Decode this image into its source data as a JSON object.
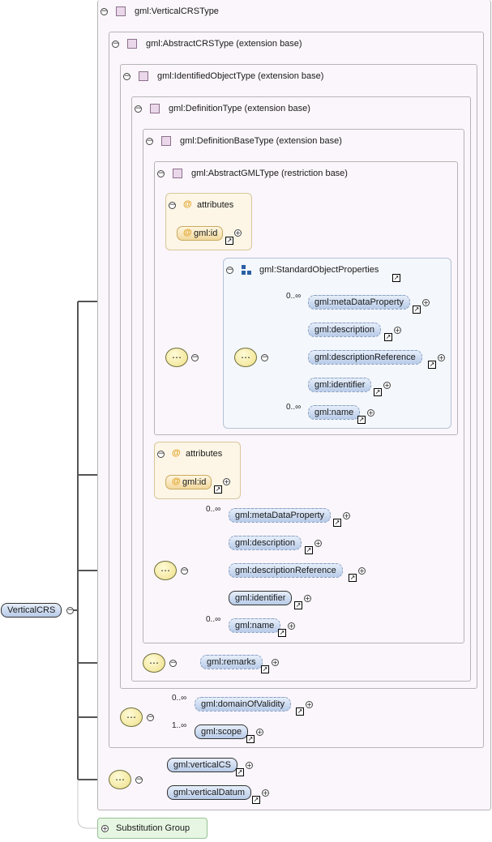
{
  "root": {
    "label": "VerticalCRS"
  },
  "types": {
    "vertical_crs": "gml:VerticalCRSType",
    "abstract_crs": "gml:AbstractCRSType (extension base)",
    "identified_object": "gml:IdentifiedObjectType (extension base)",
    "definition": "gml:DefinitionType (extension base)",
    "definition_base": "gml:DefinitionBaseType (extension base)",
    "abstract_gml": "gml:AbstractGMLType (restriction base)"
  },
  "attributes_label": "attributes",
  "attr_symbol": "@",
  "attr_id": "gml:id",
  "standard_object_properties": "gml:StandardObjectProperties",
  "sop_elements": [
    "gml:metaDataProperty",
    "gml:description",
    "gml:descriptionReference",
    "gml:identifier",
    "gml:name"
  ],
  "definition_elements": [
    "gml:metaDataProperty",
    "gml:description",
    "gml:descriptionReference",
    "gml:identifier",
    "gml:name"
  ],
  "multiplicity": {
    "zero_many": "0..∞",
    "one_many": "1..∞"
  },
  "remarks": "gml:remarks",
  "crs_elements": [
    "gml:domainOfValidity",
    "gml:scope"
  ],
  "vertical_elements": [
    "gml:verticalCS",
    "gml:verticalDatum"
  ],
  "substitution_group": "Substitution Group",
  "symbols": {
    "collapse": "−",
    "expand": "+",
    "link": "↗",
    "sequence": "⋯"
  },
  "colors": {
    "element_fill": "#c4d4ee",
    "attribute_fill": "#f6e1ad",
    "group_fill": "#f3e9a0",
    "type_box": "#fbf6fb",
    "substitution_fill": "#e6f6e2"
  }
}
